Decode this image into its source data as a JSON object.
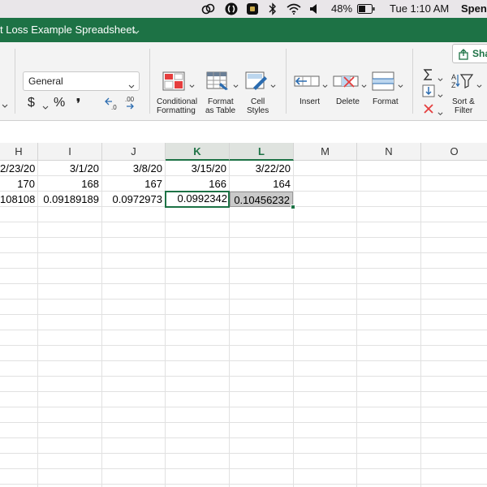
{
  "menubar": {
    "battery_percent": "48%",
    "clock": "Tue 1:10 AM",
    "user": "Spen"
  },
  "titlebar": {
    "document_title": "t Loss Example Spreadsheet"
  },
  "ribbon": {
    "number_format": "General",
    "share_label": "Sha",
    "currency_symbol": "$",
    "percent_symbol": "%",
    "comma_symbol": "❜",
    "groups": {
      "conditional_formatting": [
        "Conditional",
        "Formatting"
      ],
      "format_as_table": [
        "Format",
        "as Table"
      ],
      "cell_styles": [
        "Cell",
        "Styles"
      ],
      "insert": "Insert",
      "delete": "Delete",
      "format": "Format",
      "sort_filter": [
        "Sort &",
        "Filter"
      ]
    },
    "colors": {
      "accent": "#1d7245",
      "title_bar": "#1d7245"
    }
  },
  "sheet": {
    "columns": [
      "H",
      "I",
      "J",
      "K",
      "L",
      "M",
      "N",
      "O"
    ],
    "selected_columns": [
      "K",
      "L"
    ],
    "rows": [
      [
        "2/23/20",
        "3/1/20",
        "3/8/20",
        "3/15/20",
        "3/22/20"
      ],
      [
        "170",
        "168",
        "167",
        "166",
        "164"
      ],
      [
        "108108",
        "0.09189189",
        "0.0972973",
        "0.0992342",
        "0.10456232"
      ]
    ]
  }
}
